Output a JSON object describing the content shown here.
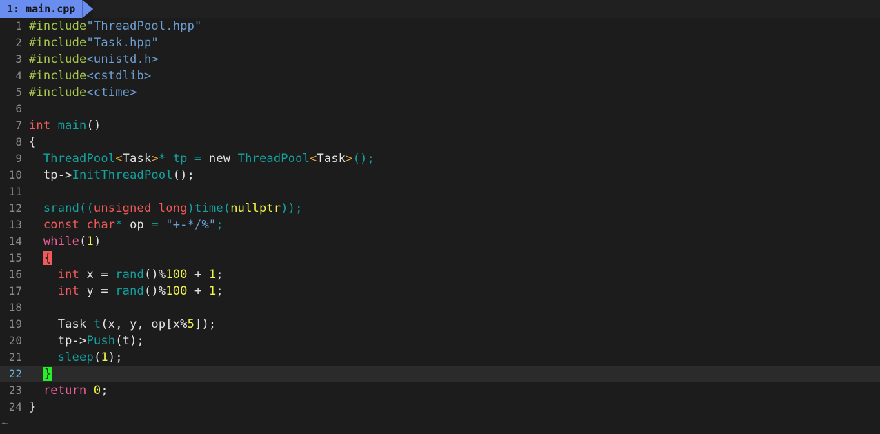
{
  "editor": {
    "name": "vim",
    "background": "#1c1c1c",
    "cursorline_background": "#2b2b2b",
    "empty_line_marker": "~"
  },
  "tabline": {
    "tabs": [
      {
        "label": "1: main.cpp",
        "active": true,
        "bg": "#6a8ef0",
        "fg": "#15161a"
      }
    ]
  },
  "colors": {
    "preprocessor": "#a6c84b",
    "string": "#6d9fd4",
    "type": "#f05a5a",
    "function": "#12a3a0",
    "keyword": "#f25f9a",
    "number": "#f2f24a",
    "plain": "#e4e4e4",
    "template_bracket": "#e8a33d",
    "match_brace_bg": "#f05a5a",
    "cursor_bg": "#24f024",
    "linenr": "#8a8a8a",
    "cursor_linenr": "#6fb4e8"
  },
  "code": {
    "language": "cpp",
    "cursor_line": 22,
    "lines": [
      {
        "n": "1",
        "text": "#include\"ThreadPool.hpp\""
      },
      {
        "n": "2",
        "text": "#include\"Task.hpp\""
      },
      {
        "n": "3",
        "text": "#include<unistd.h>"
      },
      {
        "n": "4",
        "text": "#include<cstdlib>"
      },
      {
        "n": "5",
        "text": "#include<ctime>"
      },
      {
        "n": "6",
        "text": ""
      },
      {
        "n": "7",
        "text": "int main()"
      },
      {
        "n": "8",
        "text": "{"
      },
      {
        "n": "9",
        "text": "  ThreadPool<Task>* tp = new ThreadPool<Task>();"
      },
      {
        "n": "10",
        "text": "  tp->InitThreadPool();"
      },
      {
        "n": "11",
        "text": ""
      },
      {
        "n": "12",
        "text": "  srand((unsigned long)time(nullptr));"
      },
      {
        "n": "13",
        "text": "  const char* op = \"+-*/%\";"
      },
      {
        "n": "14",
        "text": "  while(1)"
      },
      {
        "n": "15",
        "text": "  {"
      },
      {
        "n": "16",
        "text": "    int x = rand()%100 + 1;"
      },
      {
        "n": "17",
        "text": "    int y = rand()%100 + 1;"
      },
      {
        "n": "18",
        "text": ""
      },
      {
        "n": "19",
        "text": "    Task t(x, y, op[x%5]);"
      },
      {
        "n": "20",
        "text": "    tp->Push(t);"
      },
      {
        "n": "21",
        "text": "    sleep(1);"
      },
      {
        "n": "22",
        "text": "  }"
      },
      {
        "n": "23",
        "text": "  return 0;"
      },
      {
        "n": "24",
        "text": "}"
      }
    ]
  }
}
